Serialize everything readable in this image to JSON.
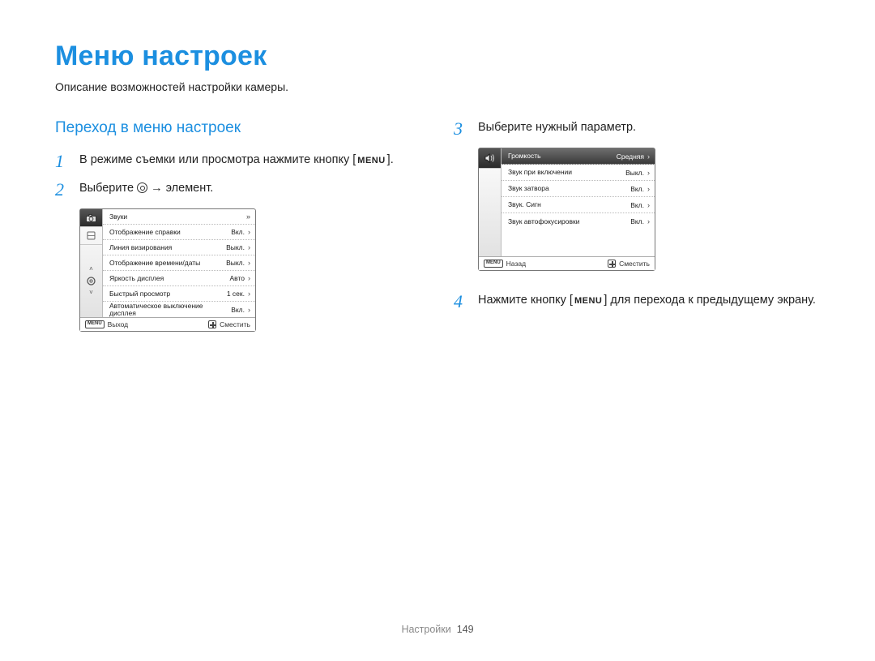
{
  "title": "Меню настроек",
  "subtitle": "Описание возможностей настройки камеры.",
  "section_heading": "Переход в меню настроек",
  "steps": {
    "s1": {
      "num": "1",
      "text_a": "В режиме съемки или просмотра нажмите кнопку",
      "text_b": "[",
      "menu_label": "MENU",
      "text_c": "]."
    },
    "s2": {
      "num": "2",
      "text_a": "Выберите ",
      "text_b": " → элемент."
    },
    "s3": {
      "num": "3",
      "text_a": "Выберите нужный параметр."
    },
    "s4": {
      "num": "4",
      "text_a": "Нажмите кнопку [",
      "menu_label": "MENU",
      "text_b": "] для перехода к предыдущему экрану."
    }
  },
  "panel1": {
    "rows": [
      {
        "label": "Звуки",
        "value": "",
        "chev": "»"
      },
      {
        "label": "Отображение справки",
        "value": "Вкл.",
        "chev": "›"
      },
      {
        "label": "Линия визирования",
        "value": "Выкл.",
        "chev": "›"
      },
      {
        "label": "Отображение времени/даты",
        "value": "Выкл.",
        "chev": "›"
      },
      {
        "label": "Яркость дисплея",
        "value": "Авто",
        "chev": "›"
      },
      {
        "label": "Быстрый просмотр",
        "value": "1 сек.",
        "chev": "›"
      },
      {
        "label": "Автоматическое выключение дисплея",
        "value": "Вкл.",
        "chev": "›"
      }
    ],
    "footer": {
      "menu_icon": "MENU",
      "left": "Выход",
      "right": "Сместить"
    }
  },
  "panel2": {
    "rows": [
      {
        "label": "Громкость",
        "value": "Средняя",
        "chev": "›",
        "selected": true
      },
      {
        "label": "Звук при включении",
        "value": "Выкл.",
        "chev": "›"
      },
      {
        "label": "Звук затвора",
        "value": "Вкл.",
        "chev": "›"
      },
      {
        "label": "Звук. Сигн",
        "value": "Вкл.",
        "chev": "›"
      },
      {
        "label": "Звук автофокусировки",
        "value": "Вкл.",
        "chev": "›"
      }
    ],
    "footer": {
      "menu_icon": "MENU",
      "left": "Назад",
      "right": "Сместить"
    }
  },
  "page_footer": {
    "label": "Настройки",
    "num": "149"
  }
}
